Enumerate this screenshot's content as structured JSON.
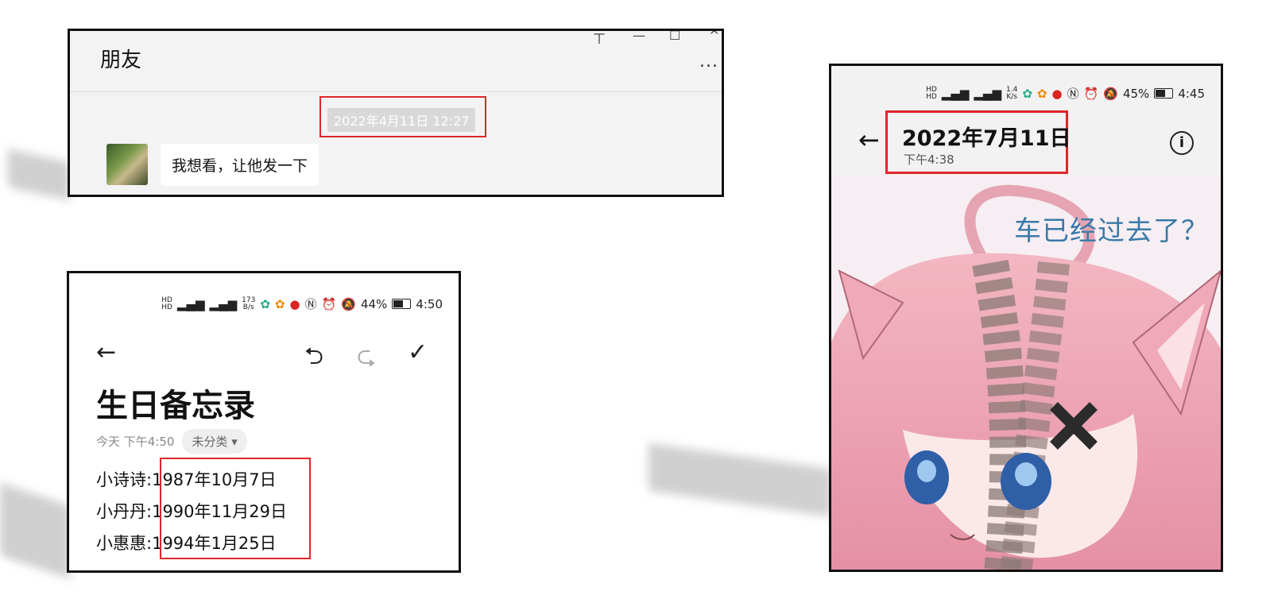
{
  "chat": {
    "title": "朋友",
    "window_controls": [
      "ㄒ",
      "—",
      "☐",
      "^"
    ],
    "more": "...",
    "timestamp": "2022年4月11日 12:27",
    "message": "我想看，让他发一下"
  },
  "memo": {
    "status": {
      "speed_top": "173",
      "speed_bottom": "B/s",
      "battery": "44%",
      "time": "4:50"
    },
    "title": "生日备忘录",
    "meta_time": "今天 下午4:50",
    "category": "未分类 ▾",
    "entries": [
      {
        "name": "小诗诗:",
        "date": "1987年10月7日"
      },
      {
        "name": "小丹丹:",
        "date": "1990年11月29日"
      },
      {
        "name": "小惠惠:",
        "date": "1994年1月25日"
      }
    ]
  },
  "phone": {
    "status": {
      "speed_top": "1.4",
      "speed_bottom": "K/s",
      "battery": "45%",
      "time": "4:45"
    },
    "date": "2022年7月11日",
    "time": "下午4:38",
    "image_text": "车已经过去了？"
  },
  "colors": {
    "highlight": "#e0262a",
    "accent_text": "#3a7aa8"
  }
}
